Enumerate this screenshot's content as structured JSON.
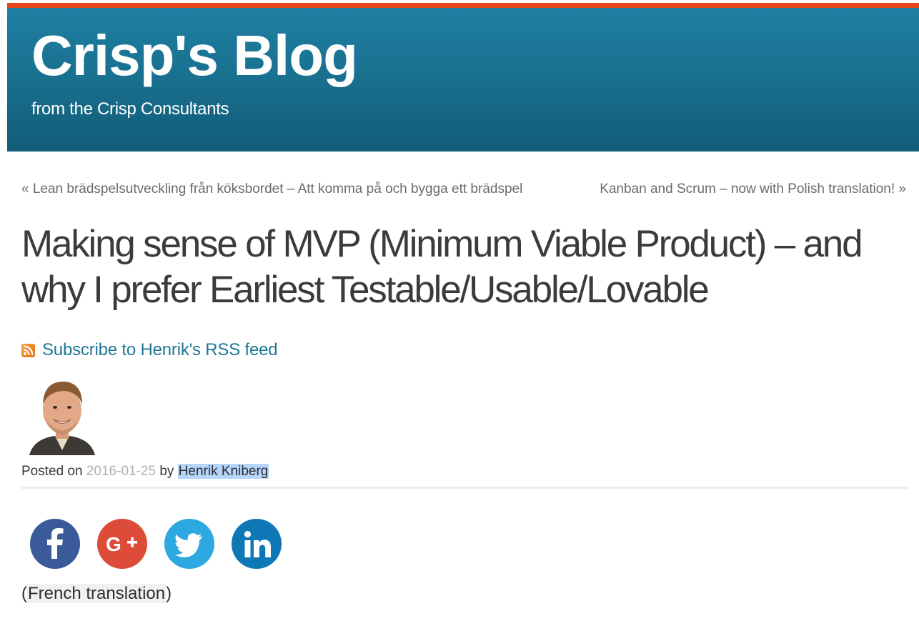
{
  "header": {
    "title": "Crisp's Blog",
    "description": "from the Crisp Consultants",
    "accent_color": "#e4461a",
    "band_color": "#19708f"
  },
  "post_nav": {
    "previous": "« Lean brädspelsutveckling från köksbordet – Att komma på och bygga ett brädspel",
    "next": "Kanban and Scrum – now with Polish translation! »"
  },
  "post": {
    "title": "Making sense of MVP (Minimum Viable Product) – and why I prefer Earliest Testable/Usable/Lovable",
    "rss_link": "Subscribe to Henrik's RSS feed",
    "meta": {
      "posted_on_label": "Posted on",
      "date": "2016-01-25",
      "by_label": "by",
      "author": "Henrik Kniberg"
    },
    "translation": {
      "open_paren": "(",
      "link": "French translation",
      "close_paren": ")"
    }
  },
  "social": [
    {
      "network": "facebook",
      "icon": "facebook-icon",
      "color": "#3b5a99"
    },
    {
      "network": "google-plus",
      "icon": "google-plus-icon",
      "color": "#dd4b39"
    },
    {
      "network": "twitter",
      "icon": "twitter-icon",
      "color": "#2da8e0"
    },
    {
      "network": "linkedin",
      "icon": "linkedin-icon",
      "color": "#0e77b5"
    }
  ]
}
